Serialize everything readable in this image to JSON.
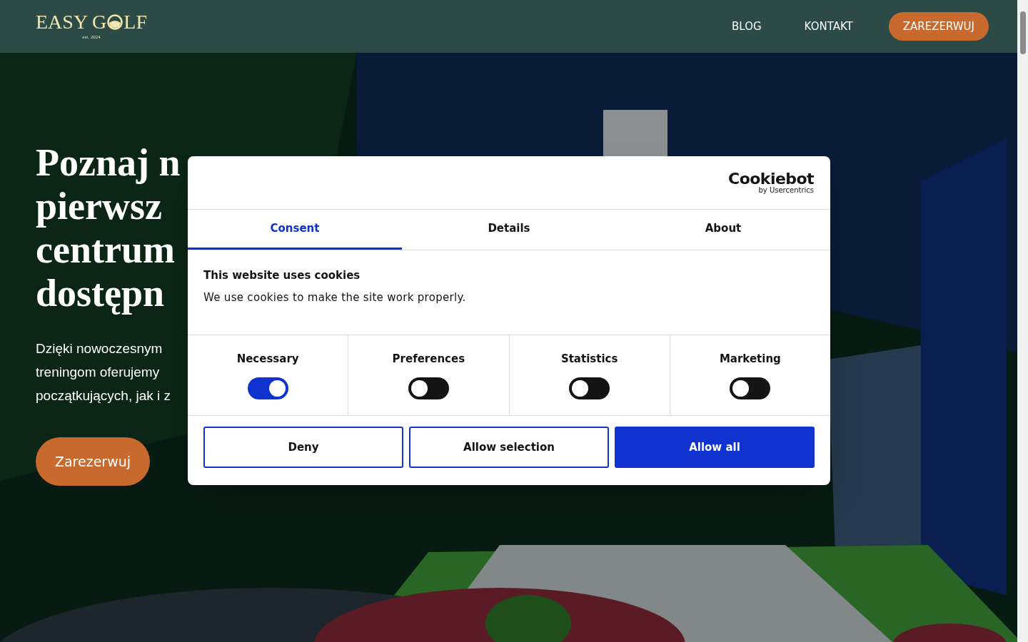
{
  "header": {
    "logo": {
      "left": "EASY G",
      "right": "LF",
      "tagline": "est. 2024"
    },
    "nav": [
      {
        "label": "BLOG",
        "kind": "link"
      },
      {
        "label": "KONTAKT",
        "kind": "link"
      },
      {
        "label": "ZAREZERWUJ",
        "kind": "button"
      }
    ]
  },
  "hero": {
    "heading_lines": [
      "Poznaj n",
      "pierwsz",
      "centrum",
      "dostępn"
    ],
    "text_lines": [
      "Dzięki nowoczesnym",
      "treningom oferujemy",
      "początkujących, jak i z"
    ],
    "button": "Zarezerwuj",
    "background": {
      "kind": "picture"
    }
  },
  "cookie_dialog": {
    "brand": "Cookiebot",
    "brand_sub": "by Usercentrics",
    "tabs": [
      {
        "label": "Consent",
        "selected": true
      },
      {
        "label": "Details",
        "selected": false
      },
      {
        "label": "About",
        "selected": false
      }
    ],
    "title": "This website uses cookies",
    "text": "We use cookies to make the site work properly.",
    "categories": [
      {
        "label": "Necessary",
        "checked": true
      },
      {
        "label": "Preferences",
        "checked": false
      },
      {
        "label": "Statistics",
        "checked": false
      },
      {
        "label": "Marketing",
        "checked": false
      }
    ],
    "buttons": [
      {
        "label": "Deny",
        "kind": "outline"
      },
      {
        "label": "Allow selection",
        "kind": "outline"
      },
      {
        "label": "Allow all",
        "kind": "primary"
      }
    ]
  }
}
